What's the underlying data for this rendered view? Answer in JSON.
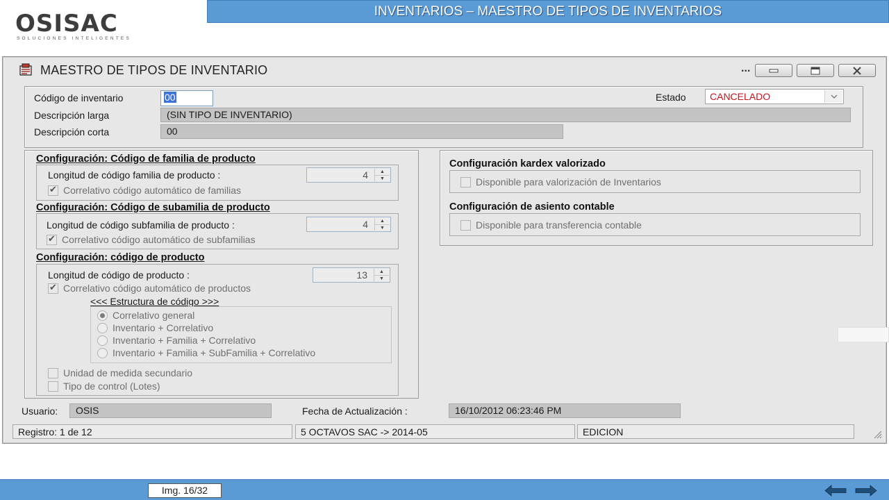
{
  "slide": {
    "logo_text": "OSISAC",
    "logo_tagline": "SOLUCIONES INTELIGENTES",
    "banner_title": "INVENTARIOS – MAESTRO DE TIPOS DE INVENTARIOS",
    "image_counter": "Img. 16/32"
  },
  "window": {
    "title": "MAESTRO DE TIPOS DE INVENTARIO",
    "menu_dots": "...",
    "header": {
      "codigo_label": "Código de inventario",
      "codigo_value": "00",
      "estado_label": "Estado",
      "estado_value": "CANCELADO",
      "desc_larga_label": "Descripción larga",
      "desc_larga_value": "(SIN TIPO DE INVENTARIO)",
      "desc_corta_label": "Descripción corta",
      "desc_corta_value": "00"
    },
    "familia": {
      "title": "Configuración: Código de familia de producto",
      "length_label": "Longitud de código familia de producto :",
      "length_value": "4",
      "auto_label": "Correlativo código automático de familias",
      "auto_checked": true
    },
    "subfamilia": {
      "title": "Configuración: Código de subamilia de producto",
      "length_label": "Longitud de código subfamilia de producto :",
      "length_value": "4",
      "auto_label": "Correlativo código automático de subfamilias",
      "auto_checked": true
    },
    "producto": {
      "title": "Configuración: código de producto",
      "length_label": "Longitud de código de producto :",
      "length_value": "13",
      "auto_label": "Correlativo código automático de productos",
      "auto_checked": true,
      "structure_title": "<<< Estructura de código >>>",
      "structure_options": [
        "Correlativo general",
        "Inventario + Correlativo",
        "Inventario + Familia + Correlativo",
        "Inventario + Familia + SubFamilia + Correlativo"
      ],
      "structure_selected": "Correlativo general",
      "unidad_label": "Unidad de medida secundario",
      "lotes_label": "Tipo de control (Lotes)"
    },
    "kardex": {
      "title": "Configuración kardex valorizado",
      "option_label": "Disponible para valorización de Inventarios"
    },
    "asiento": {
      "title": "Configuración de asiento contable",
      "option_label": "Disponible para transferencia contable"
    },
    "footer_fields": {
      "usuario_label": "Usuario:",
      "usuario_value": "OSIS",
      "fecha_label": "Fecha de Actualización :",
      "fecha_value": "16/10/2012 06:23:46 PM"
    },
    "statusbar": {
      "registro": "Registro: 1 de 12",
      "empresa": "5 OCTAVOS SAC -> 2014-05",
      "modo": "EDICION"
    }
  }
}
